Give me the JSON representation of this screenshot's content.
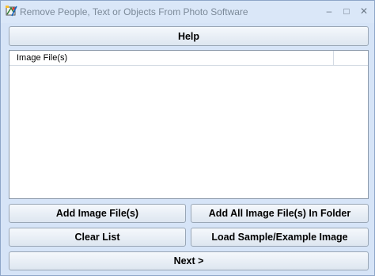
{
  "window": {
    "title": "Remove People, Text or Objects From Photo Software",
    "controls": {
      "minimize": "–",
      "maximize": "□",
      "close": "✕"
    },
    "icon": "app-paint-icon"
  },
  "buttons": {
    "help": "Help",
    "add_files": "Add Image File(s)",
    "add_folder": "Add All Image File(s) In Folder",
    "clear_list": "Clear List",
    "load_sample": "Load Sample/Example Image",
    "next": "Next >"
  },
  "file_list": {
    "columns": [
      "Image File(s)"
    ],
    "rows": []
  }
}
